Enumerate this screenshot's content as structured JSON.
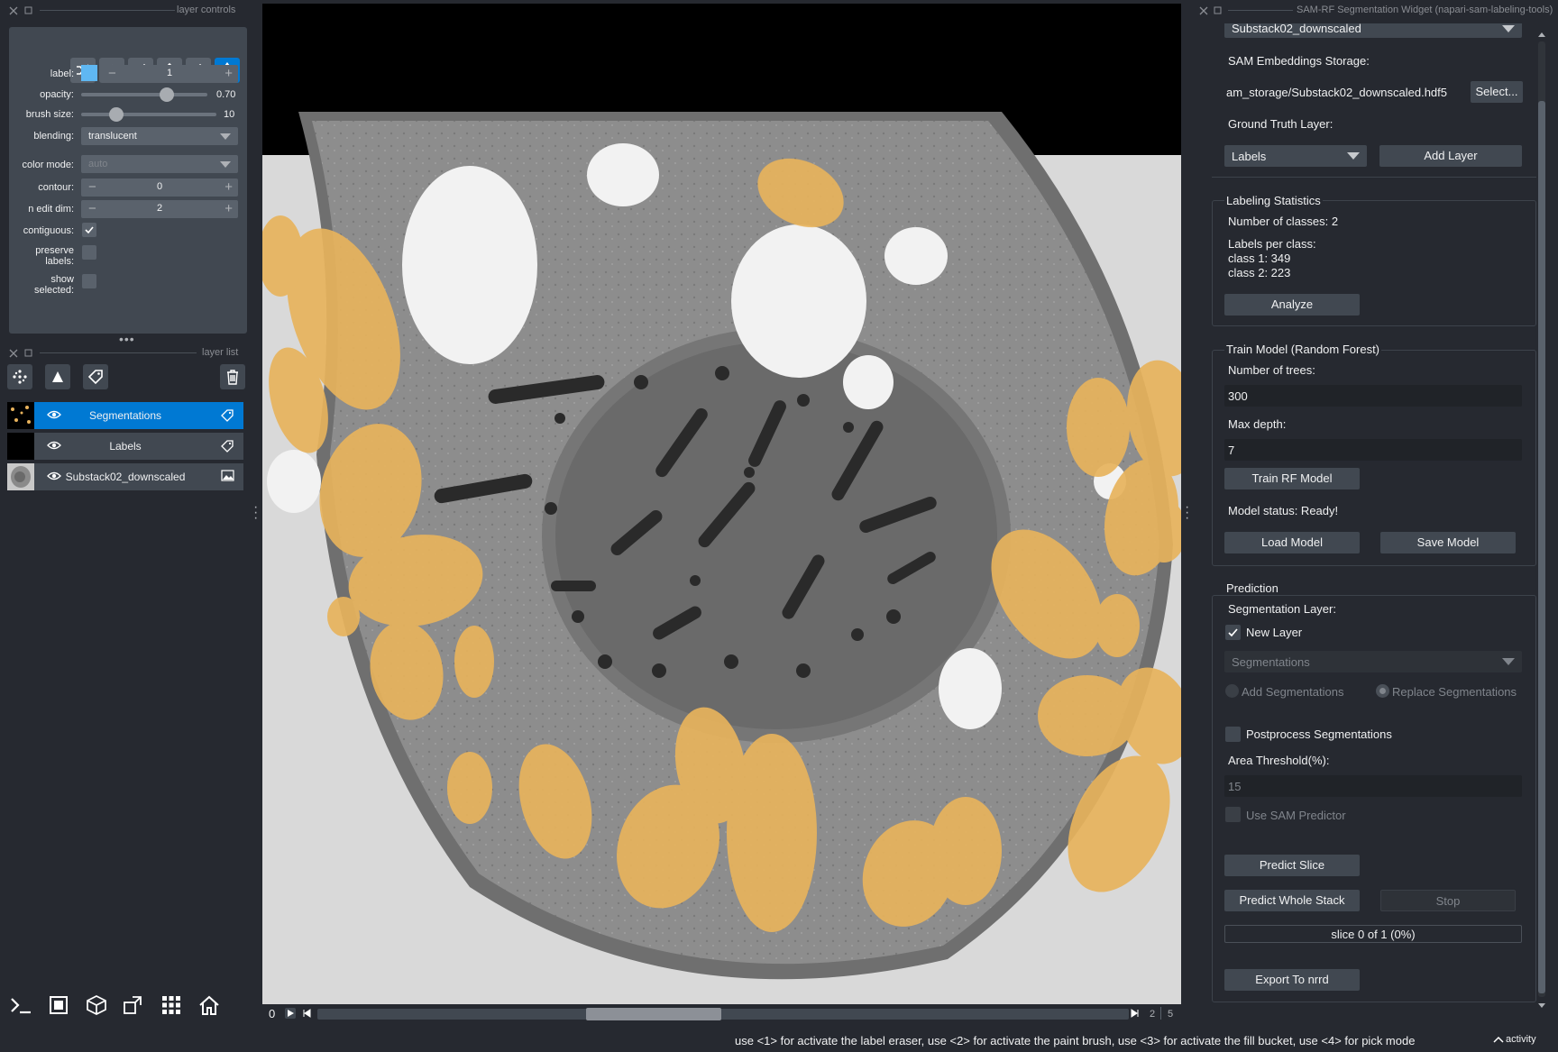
{
  "left_dock": {
    "controls_title": "layer controls",
    "layer_list_title": "layer list",
    "label_label": "label:",
    "label_value": "1",
    "opacity_label": "opacity:",
    "opacity_value": "0.70",
    "opacity_level": 0.7,
    "brush_label": "brush size:",
    "brush_value": "10",
    "blending_label": "blending:",
    "blending_value": "translucent",
    "color_mode_label": "color mode:",
    "color_mode_value": "auto",
    "contour_label": "contour:",
    "contour_value": "0",
    "n_edit_label": "n edit dim:",
    "n_edit_value": "2",
    "contiguous_label": "contiguous:",
    "contiguous_checked": true,
    "preserve_label_1": "preserve",
    "preserve_label_2": "labels:",
    "show_label_1": "show",
    "show_label_2": "selected:",
    "label_color": "#5fb7f2",
    "layers": [
      {
        "name": "Segmentations",
        "selected": true,
        "icon": "tag-icon"
      },
      {
        "name": "Labels",
        "selected": false,
        "icon": "tag-icon"
      },
      {
        "name": "Substack02_downscaled",
        "selected": false,
        "icon": "image-icon"
      }
    ]
  },
  "viewer": {
    "slider_value": "0",
    "frame_current": "2",
    "frame_total": "5"
  },
  "right_dock": {
    "title": "SAM-RF Segmentation Widget (napari-sam-labeling-tools)",
    "image_layer": "Substack02_downscaled",
    "storage_label": "SAM Embeddings Storage:",
    "storage_path": "am_storage/Substack02_downscaled.hdf5",
    "select_button": "Select...",
    "gt_label": "Ground Truth Layer:",
    "gt_value": "Labels",
    "add_layer_button": "Add Layer",
    "stats_title": "Labeling Statistics",
    "num_classes": "Number of classes: 2",
    "labels_per_class": "Labels per class:",
    "class1": "class 1: 349",
    "class2": "class 2: 223",
    "analyze_button": "Analyze",
    "train_title": "Train Model (Random Forest)",
    "trees_label": "Number of trees:",
    "trees_value": "300",
    "depth_label": "Max depth:",
    "depth_value": "7",
    "train_button": "Train RF Model",
    "model_status": "Model status: Ready!",
    "load_button": "Load Model",
    "save_button": "Save Model",
    "prediction_title": "Prediction",
    "seg_layer_label": "Segmentation Layer:",
    "new_layer_label": "New Layer",
    "new_layer_checked": true,
    "seg_combo": "Segmentations",
    "add_seg_label": "Add Segmentations",
    "replace_seg_label": "Replace Segmentations",
    "postprocess_label": "Postprocess Segmentations",
    "area_label": "Area Threshold(%):",
    "area_value": "15",
    "use_sam_label": "Use SAM Predictor",
    "predict_slice_button": "Predict Slice",
    "predict_stack_button": "Predict Whole Stack",
    "stop_button": "Stop",
    "progress_text": "slice 0 of 1 (0%)",
    "progress_level": 0,
    "export_button": "Export To nrrd"
  },
  "status": {
    "message": "use <1> for activate the label eraser, use <2> for activate the paint brush, use <3> for activate the fill bucket, use <4> for pick mode",
    "activity": "activity"
  },
  "colors": {
    "accent": "#0079d3",
    "segmentation": "#e8b35c",
    "background": "#262930"
  }
}
